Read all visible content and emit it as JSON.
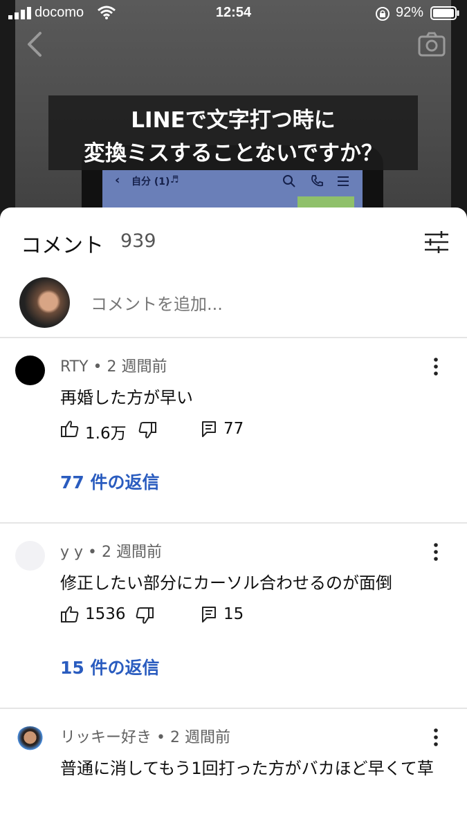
{
  "status_bar": {
    "carrier": "docomo",
    "time": "12:54",
    "battery_percent": "92%"
  },
  "video": {
    "caption_line1": "LINEで文字打つ時に",
    "caption_line2": "変換ミスすることないですか？",
    "chat_title": "自分 (1)"
  },
  "comments_panel": {
    "title": "コメント",
    "count": "939",
    "add_placeholder": "コメントを追加..."
  },
  "comments": [
    {
      "author": "RTY",
      "time": "2 週間前",
      "text": "再婚した方が早い",
      "likes": "1.6万",
      "reply_count": "77",
      "replies_link": "77 件の返信"
    },
    {
      "author": "y y",
      "time": "2 週間前",
      "text": "修正したい部分にカーソル合わせるのが面倒",
      "likes": "1536",
      "reply_count": "15",
      "replies_link": "15 件の返信"
    },
    {
      "author": "リッキー好き",
      "time": "2 週間前",
      "text": "普通に消してもう1回打った方がバカほど早くて草"
    }
  ]
}
